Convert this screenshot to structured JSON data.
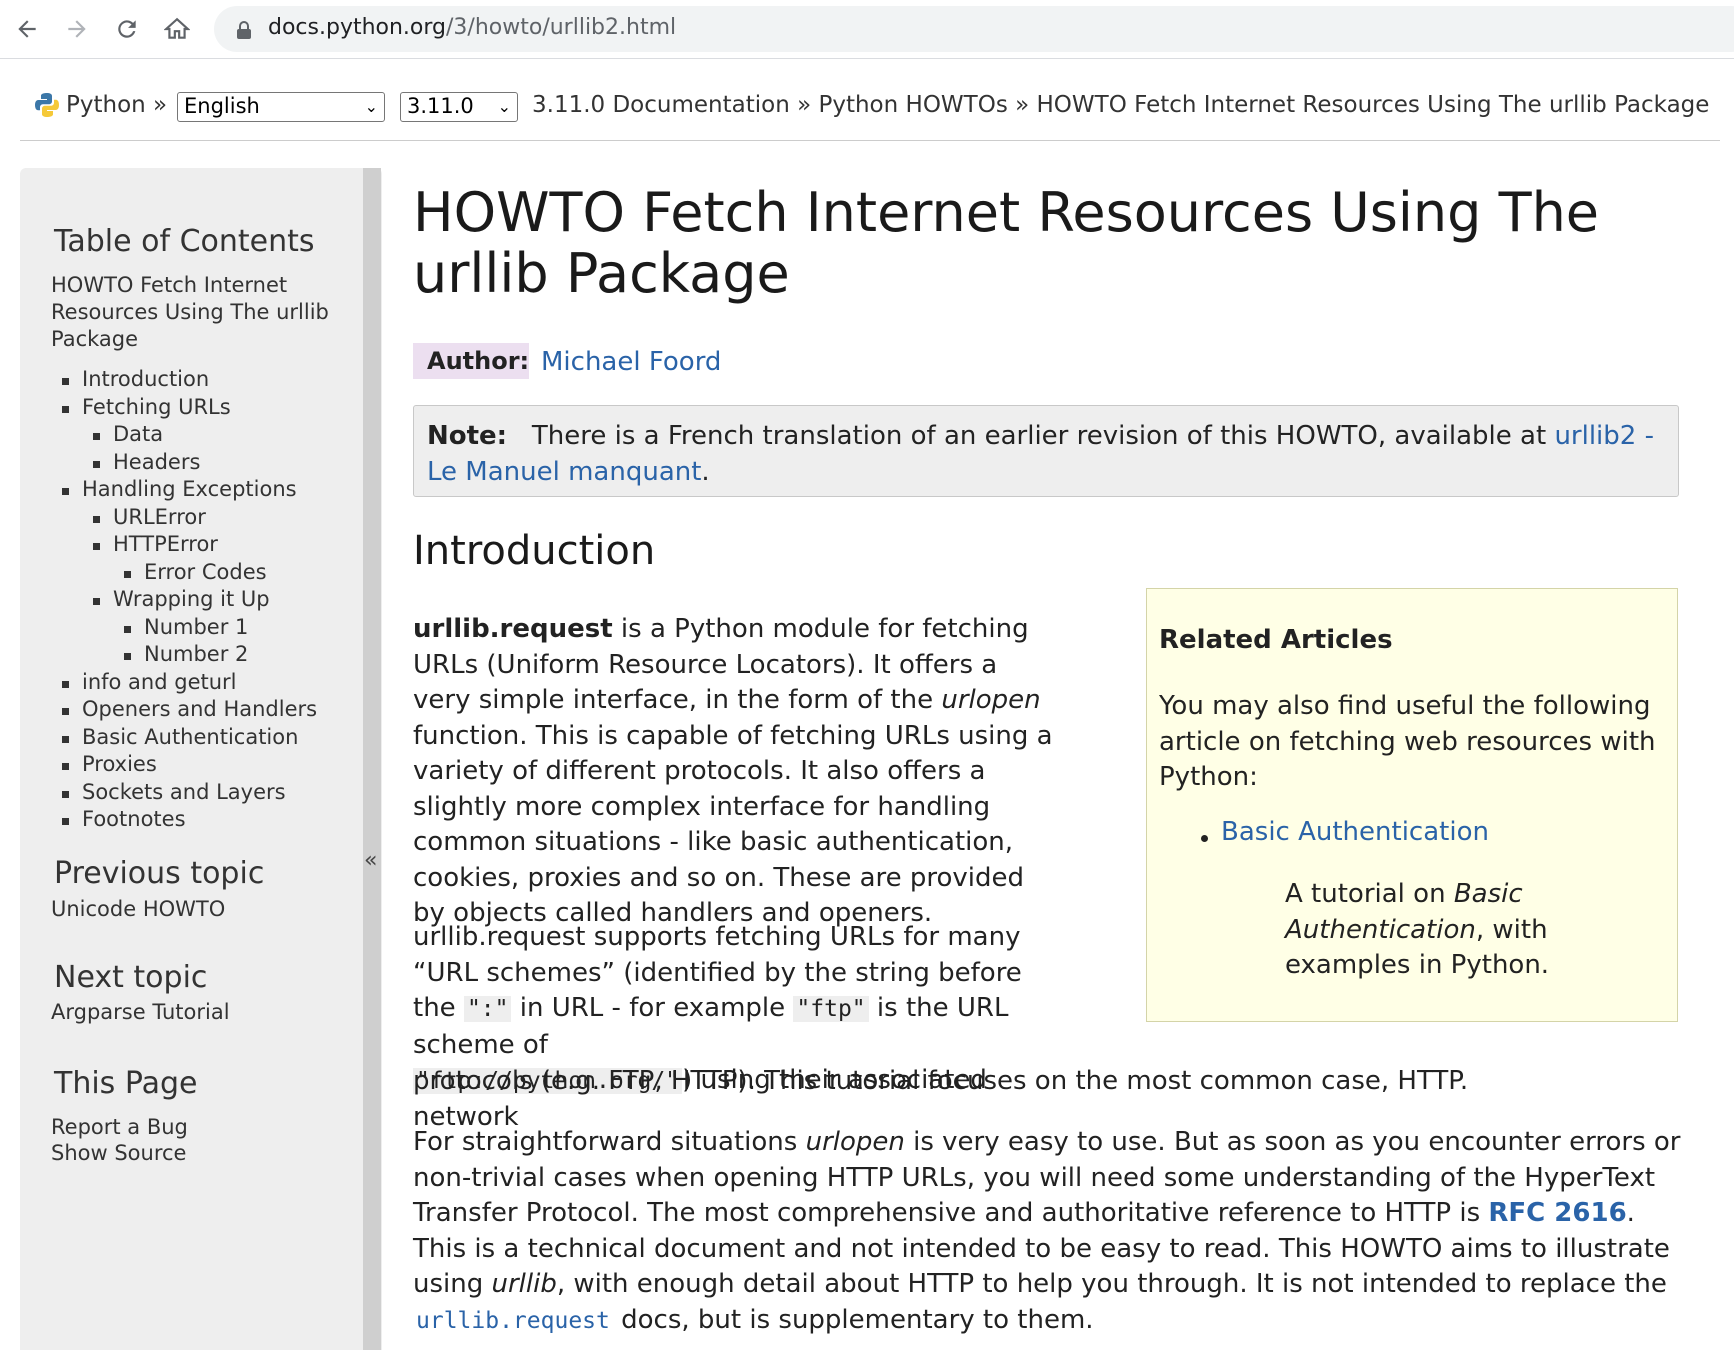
{
  "browser": {
    "url_host": "docs.python.org",
    "url_path": "/3/howto/urllib2.html"
  },
  "topbar": {
    "python_label": "Python",
    "sep": "»",
    "language": "English",
    "version": "3.11.0",
    "crumb_docs": "3.11.0 Documentation",
    "crumb_howtos": "Python HOWTOs",
    "crumb_current": "HOWTO Fetch Internet Resources Using The urllib Package"
  },
  "sidebar": {
    "toc_heading": "Table of Contents",
    "toc_root": "HOWTO Fetch Internet Resources Using The urllib Package",
    "toc": [
      "Introduction",
      "Fetching URLs",
      "Data",
      "Headers",
      "Handling Exceptions",
      "URLError",
      "HTTPError",
      "Error Codes",
      "Wrapping it Up",
      "Number 1",
      "Number 2",
      "info and geturl",
      "Openers and Handlers",
      "Basic Authentication",
      "Proxies",
      "Sockets and Layers",
      "Footnotes"
    ],
    "prev_heading": "Previous topic",
    "prev_link": "Unicode HOWTO",
    "next_heading": "Next topic",
    "next_link": "Argparse Tutorial",
    "page_heading": "This Page",
    "report_bug": "Report a Bug",
    "show_source": "Show Source",
    "collapse": "«"
  },
  "main": {
    "title": "HOWTO Fetch Internet Resources Using The urllib Package",
    "author_label": "Author:",
    "author_name": "Michael Foord",
    "note_label": "Note:",
    "note_text": "There is a French translation of an earlier revision of this HOWTO, available at",
    "note_link": "urllib2 - Le Manuel manquant",
    "intro_heading": "Introduction",
    "p1_bold": "urllib.request",
    "p1_a": " is a Python module for fetching URLs (Uniform Resource Locators). It offers a very simple interface, in the form of the ",
    "p1_em": "urlopen",
    "p1_b": " function. This is capable of fetching URLs using a variety of different protocols. It also offers a slightly more complex interface for handling common situations - like basic authentication, cookies, proxies and so on. These are provided by objects called handlers and openers.",
    "p2_a": "urllib.request supports fetching URLs for many “URL schemes” (identified by the string before the ",
    "p2_code1": "\":\"",
    "p2_b": " in URL - for example ",
    "p2_code2": "\"ftp\"",
    "p2_c": " is the URL scheme of",
    "p2_code3": "\"ftp://python.org/\"",
    "p2_d": ") using their associated network",
    "p2_last": "protocols (e.g. FTP, HTTP). This tutorial focuses on the most common case, HTTP.",
    "p3_a": "For straightforward situations ",
    "p3_em1": "urlopen",
    "p3_b": " is very easy to use. But as soon as you encounter errors or non-trivial cases when opening HTTP URLs, you will need some understanding of the HyperText Transfer Protocol. The most comprehensive and authoritative reference to HTTP is ",
    "p3_rfc": "RFC 2616",
    "p3_c": ". This is a technical document and not intended to be easy to read. This HOWTO aims to illustrate using ",
    "p3_em2": "urllib",
    "p3_d": ", with enough detail about HTTP to help you through. It is not intended to replace the ",
    "p3_code": "urllib.request",
    "p3_e": " docs, but is supplementary to them."
  },
  "related": {
    "title": "Related Articles",
    "text": "You may also find useful the following article on fetching web resources with Python:",
    "link": "Basic Authentication",
    "desc_a": "A tutorial on ",
    "desc_em": "Basic Authentication",
    "desc_b": ", with examples in Python."
  }
}
